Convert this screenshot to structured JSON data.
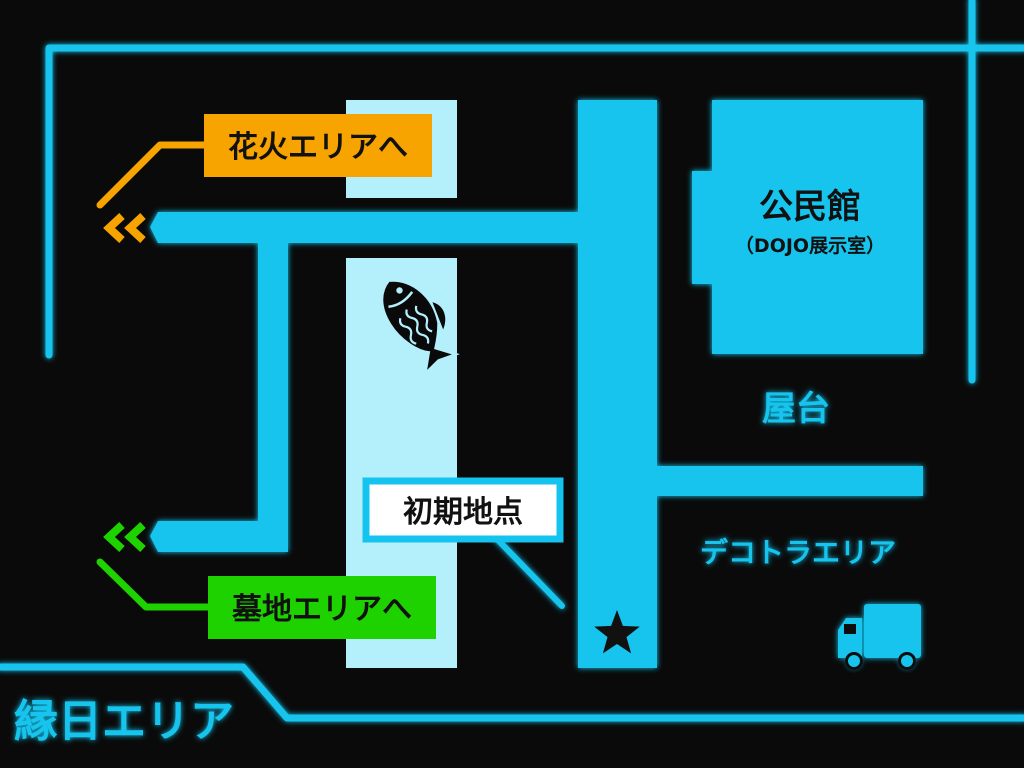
{
  "colors": {
    "background": "#0a0a0a",
    "neon_blue": "#14c4ee",
    "light_road": "#b4f0fc",
    "orange": "#f7a400",
    "green": "#1ed200",
    "dark_text": "#111111"
  },
  "labels": {
    "fireworks_area": "花火エリアへ",
    "cemetery_area": "墓地エリアへ",
    "start_point": "初期地点",
    "community_hall": "公民館",
    "community_hall_sub": "（DOJO展示室）",
    "food_stalls": "屋台",
    "decotora_area": "デコトラエリア",
    "ennichi_area": "縁日エリア"
  },
  "icons": {
    "fish": "tai-fish-icon",
    "star": "star-icon",
    "truck": "truck-icon",
    "chevrons_fireworks": "double-chevron-left-icon",
    "chevrons_cemetery": "double-chevron-left-icon"
  }
}
